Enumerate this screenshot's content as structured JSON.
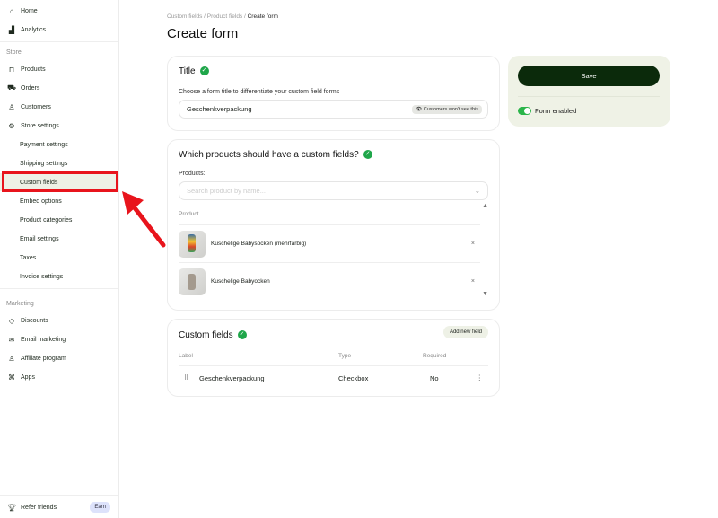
{
  "sidebar": {
    "top": [
      {
        "label": "Home",
        "icon": "home-icon"
      },
      {
        "label": "Analytics",
        "icon": "analytics-icon"
      }
    ],
    "store_section": "Store",
    "store": [
      {
        "label": "Products"
      },
      {
        "label": "Orders"
      },
      {
        "label": "Customers"
      },
      {
        "label": "Store settings"
      }
    ],
    "settings_sub": [
      "Payment settings",
      "Shipping settings",
      "Custom fields",
      "Embed options",
      "Product categories",
      "Email settings",
      "Taxes",
      "Invoice settings"
    ],
    "marketing_section": "Marketing",
    "marketing": [
      {
        "label": "Discounts"
      },
      {
        "label": "Email marketing"
      },
      {
        "label": "Affiliate program"
      },
      {
        "label": "Apps"
      }
    ],
    "refer": "Refer friends",
    "earn": "Earn"
  },
  "breadcrumb": [
    "Custom fields",
    "Product fields",
    "Create form"
  ],
  "page_title": "Create form",
  "title_card": {
    "heading": "Title",
    "label": "Choose a form title to differentiate your custom field forms",
    "value": "Geschenkverpackung",
    "badge": "Customers won't see this"
  },
  "products_card": {
    "heading": "Which products should have a custom fields?",
    "label": "Products:",
    "placeholder": "Search product by name...",
    "column": "Product",
    "items": [
      "Kuschelige Babysocken (mehrfarbig)",
      "Kuschelige Babyocken"
    ],
    "remove": "×"
  },
  "fields_card": {
    "heading": "Custom fields",
    "add": "Add new field",
    "columns": [
      "Label",
      "Type",
      "Required"
    ],
    "rows": [
      {
        "label": "Geschenkverpackung",
        "type": "Checkbox",
        "required": "No"
      }
    ]
  },
  "side_panel": {
    "save": "Save",
    "toggle_label": "Form enabled",
    "enabled": true
  }
}
